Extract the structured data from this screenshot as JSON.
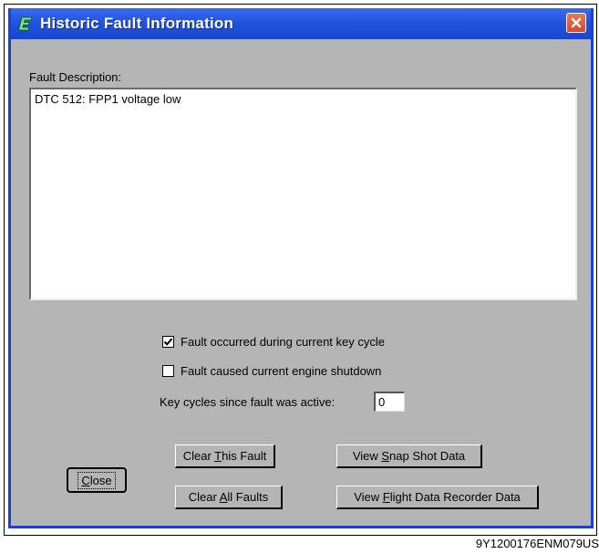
{
  "window": {
    "title": "Historic Fault Information"
  },
  "fault_description": {
    "label": "Fault Description:",
    "text": "DTC 512: FPP1 voltage low"
  },
  "options": {
    "occurred_current_cycle": {
      "label": "Fault occurred during current key cycle",
      "checked": true
    },
    "caused_shutdown": {
      "label": "Fault caused current engine shutdown",
      "checked": false
    }
  },
  "key_cycles": {
    "label": "Key cycles since fault was active:",
    "value": "0"
  },
  "buttons": {
    "close": {
      "pre": "",
      "mnemonic": "C",
      "post": "lose"
    },
    "clear_this": {
      "pre": "Clear ",
      "mnemonic": "T",
      "post": "his Fault"
    },
    "clear_all": {
      "pre": "Clear ",
      "mnemonic": "A",
      "post": "ll Faults"
    },
    "snapshot": {
      "pre": "View ",
      "mnemonic": "S",
      "post": "nap Shot Data"
    },
    "flight_data": {
      "pre": "View ",
      "mnemonic": "F",
      "post": "light Data Recorder Data"
    }
  },
  "caption": "9Y1200176ENM079US",
  "colors": {
    "titlebar": "#2456e0",
    "dialog_bg": "#b5b5b5",
    "close_button": "#d64a26"
  },
  "icons": {
    "title": "app-e-icon",
    "close": "close-x-icon",
    "check": "checkmark-icon"
  }
}
